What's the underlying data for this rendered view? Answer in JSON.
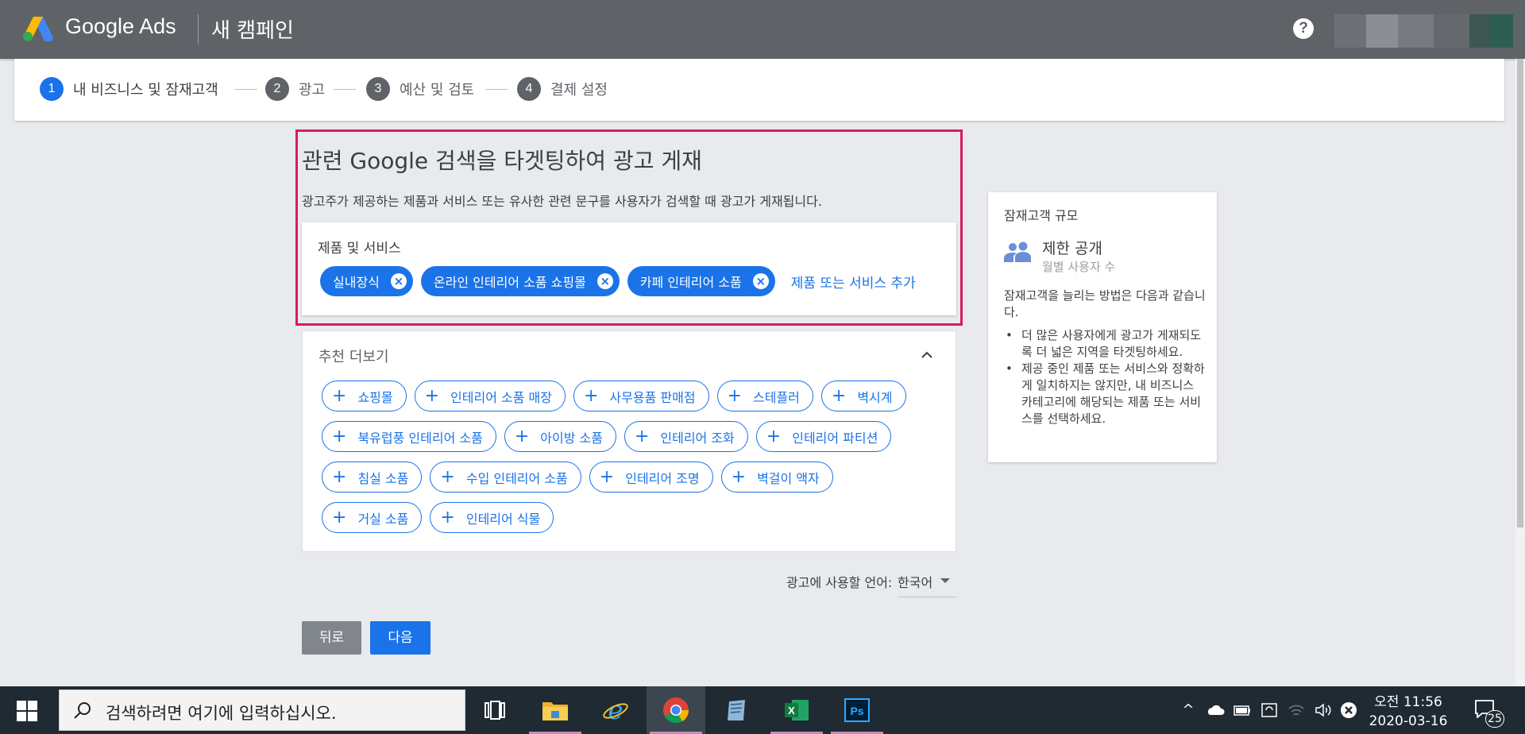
{
  "header": {
    "brand": "Google Ads",
    "page_name": "새 캠페인",
    "help_icon": "?"
  },
  "steps": [
    {
      "num": "1",
      "label": "내 비즈니스 및 잠재고객"
    },
    {
      "num": "2",
      "label": "광고"
    },
    {
      "num": "3",
      "label": "예산 및 검토"
    },
    {
      "num": "4",
      "label": "결제 설정"
    }
  ],
  "main": {
    "title": "관련 Google 검색을 타겟팅하여 광고 게재",
    "description": "광고주가 제공하는 제품과 서비스 또는 유사한 관련 문구를 사용자가 검색할 때 광고가 게재됩니다."
  },
  "products": {
    "label": "제품 및 서비스",
    "chips": [
      "실내장식",
      "온라인 인테리어 소품 쇼핑몰",
      "카페 인테리어 소품"
    ],
    "add_link": "제품 또는 서비스 추가"
  },
  "recommendations": {
    "title": "추천 더보기",
    "items": [
      "쇼핑몰",
      "인테리어 소품 매장",
      "사무용품 판매점",
      "스테플러",
      "벽시계",
      "북유럽풍 인테리어 소품",
      "아이방 소품",
      "인테리어 조화",
      "인테리어 파티션",
      "침실 소품",
      "수입 인테리어 소품",
      "인테리어 조명",
      "벽걸이 액자",
      "거실 소품",
      "인테리어 식물"
    ]
  },
  "language": {
    "label": "광고에 사용할 언어:",
    "value": "한국어"
  },
  "buttons": {
    "back": "뒤로",
    "next": "다음"
  },
  "audience": {
    "title": "잠재고객 규모",
    "size": "제한 공개",
    "size_sub": "월별 사용자 수",
    "intro": "잠재고객을 늘리는 방법은 다음과 같습니다.",
    "tips": [
      "더 많은 사용자에게 광고가 게재되도록 더 넓은 지역을 타겟팅하세요.",
      "제공 중인 제품 또는 서비스와 정확하게 일치하지는 않지만, 내 비즈니스 카테고리에 해당되는 제품 또는 서비스를 선택하세요."
    ]
  },
  "taskbar": {
    "search_placeholder": "검색하려면 여기에 입력하십시오.",
    "clock_time": "오전 11:56",
    "clock_date": "2020-03-16",
    "notification_count": "25",
    "apps": [
      "task-view-icon",
      "file-explorer-icon",
      "internet-explorer-icon",
      "chrome-icon",
      "notepad-icon",
      "excel-icon",
      "photoshop-icon"
    ]
  },
  "colors": {
    "topbar": "#5f6368",
    "accent": "#1a73e8",
    "highlight_border": "#d81b60",
    "taskbar": "#1f2a33"
  }
}
